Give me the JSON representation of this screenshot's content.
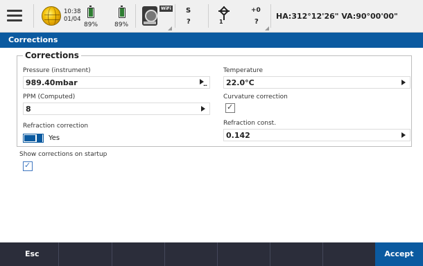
{
  "status_bar": {
    "time": "10:38",
    "date": "01/04",
    "battery1_pct": "89%",
    "battery2_pct": "89%",
    "battery1_level": 0.89,
    "battery2_level": 0.89,
    "wifi_label": "WiFi",
    "s_label": "S",
    "s_value": "?",
    "prism_count": "1",
    "offset_top": "+0",
    "offset_value": "?",
    "angles": "HA:312°12'26\"  VA:90°00'00\"",
    "icons": [
      "menu-icon",
      "globe-icon",
      "battery-icon",
      "instrument-icon",
      "prism-target-icon"
    ]
  },
  "title": "Corrections",
  "group": {
    "title": "Corrections",
    "pressure_label": "Pressure (instrument)",
    "pressure_value": "989.40mbar",
    "temperature_label": "Temperature",
    "temperature_value": "22.0°C",
    "ppm_label": "PPM (Computed)",
    "ppm_value": "8",
    "curvature_label": "Curvature correction",
    "curvature_checked": true,
    "refraction_label": "Refraction correction",
    "refraction_toggle_label": "Yes",
    "refraction_on": true,
    "refraction_const_label": "Refraction const.",
    "refraction_const_value": "0.142"
  },
  "startup": {
    "label": "Show corrections on startup",
    "checked": true
  },
  "bottom_bar": {
    "esc_label": "Esc",
    "accept_label": "Accept"
  },
  "colors": {
    "accent": "#0b5aa0",
    "bottom_bar": "#2b2d3a",
    "battery": "#2e7d32"
  }
}
